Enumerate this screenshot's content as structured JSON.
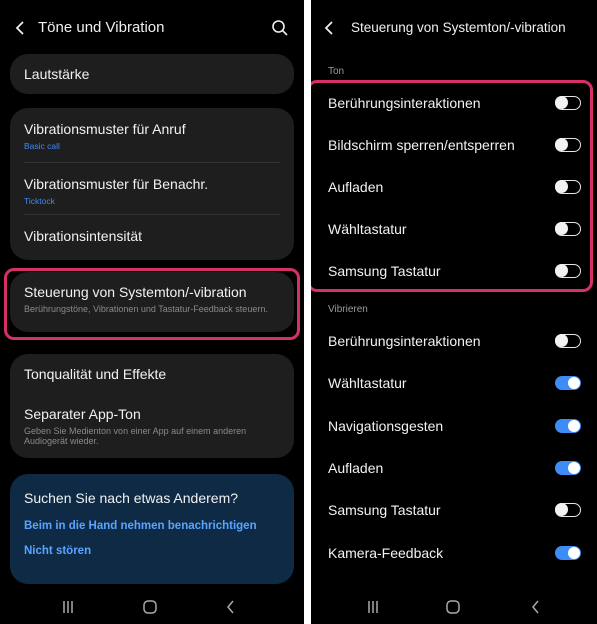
{
  "colors": {
    "accent": "#3e8cf5",
    "highlight": "#d6306a",
    "link": "#5aa4ff",
    "subtitle_link": "#3d8af7"
  },
  "left": {
    "title": "Töne und Vibration",
    "items": {
      "lautstaerke": "Lautstärke",
      "vib_anruf": "Vibrationsmuster für Anruf",
      "vib_anruf_sub": "Basic call",
      "vib_benachr": "Vibrationsmuster für Benachr.",
      "vib_benachr_sub": "Ticktock",
      "vib_intens": "Vibrationsintensität",
      "steuerung": "Steuerung von Systemton/-vibration",
      "steuerung_sub": "Berührungstöne, Vibrationen und Tastatur-Feedback steuern.",
      "tonqualitaet": "Tonqualität und Effekte",
      "separater": "Separater App-Ton",
      "separater_sub": "Geben Sie Medienton von einer App auf einem anderen Audiogerät wieder."
    },
    "suggest": {
      "heading": "Suchen Sie nach etwas Anderem?",
      "link1": "Beim in die Hand nehmen benachrichtigen",
      "link2": "Nicht stören"
    }
  },
  "right": {
    "title": "Steuerung von Systemton/-vibration",
    "ton_label": "Ton",
    "ton_items": [
      {
        "label": "Berührungsinteraktionen",
        "on": false
      },
      {
        "label": "Bildschirm sperren/entsperren",
        "on": false
      },
      {
        "label": "Aufladen",
        "on": false
      },
      {
        "label": "Wähltastatur",
        "on": false
      },
      {
        "label": "Samsung Tastatur",
        "on": false
      }
    ],
    "vib_label": "Vibrieren",
    "vib_items": [
      {
        "label": "Berührungsinteraktionen",
        "on": false
      },
      {
        "label": "Wähltastatur",
        "on": true
      },
      {
        "label": "Navigationsgesten",
        "on": true
      },
      {
        "label": "Aufladen",
        "on": true
      },
      {
        "label": "Samsung Tastatur",
        "on": false
      },
      {
        "label": "Kamera-Feedback",
        "on": true
      }
    ]
  },
  "icons": [
    "back-icon",
    "search-icon",
    "recent-apps-icon",
    "home-icon",
    "nav-back-icon"
  ]
}
